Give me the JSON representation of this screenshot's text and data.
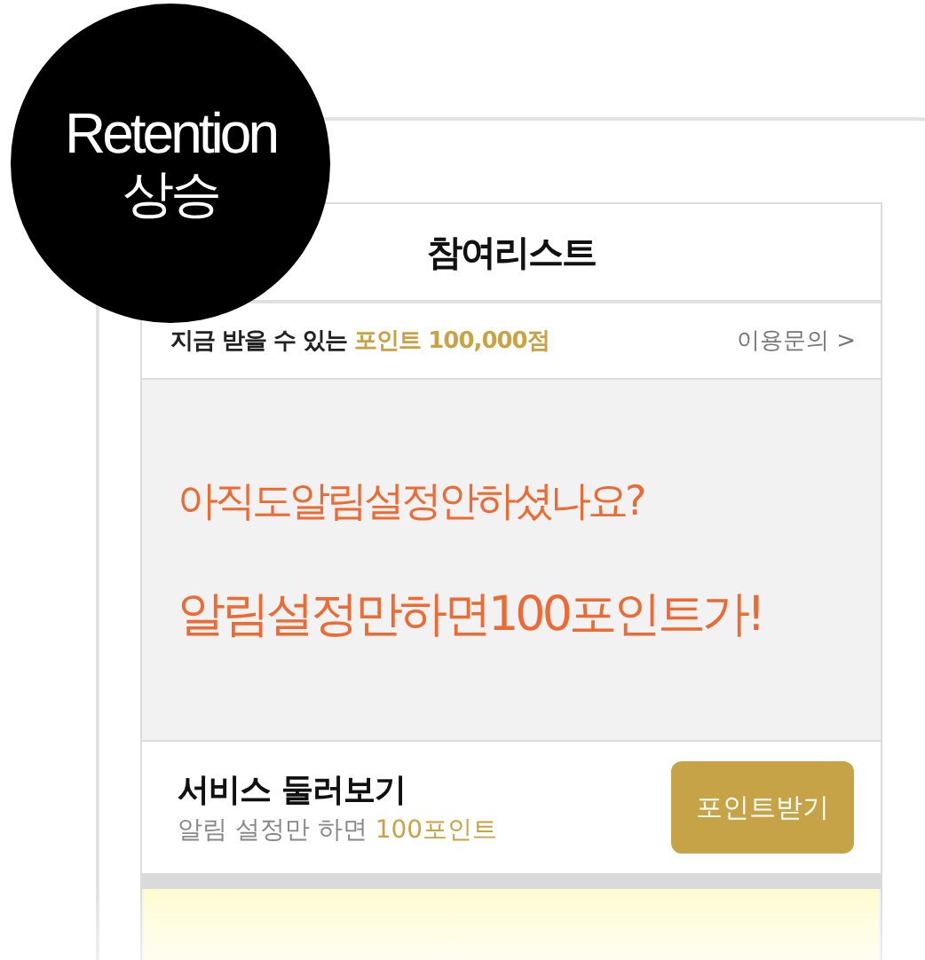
{
  "badge": {
    "lines": [
      "Retention",
      "상승"
    ]
  },
  "screen": {
    "title": "참여리스트",
    "points_bar": {
      "text": "지금 받을 수 있는",
      "highlight": "포인트 100,000점",
      "link": "이용문의 >"
    },
    "promo": {
      "lines": [
        "아직도알림설정안하셨나요?",
        "알림설정만하면100포인트가!"
      ]
    },
    "service": {
      "title": "서비스 둘러보기",
      "subtitle": "알림 설정만 하면",
      "subtitle_highlight": "100포인트",
      "button": "포인트받기"
    }
  }
}
